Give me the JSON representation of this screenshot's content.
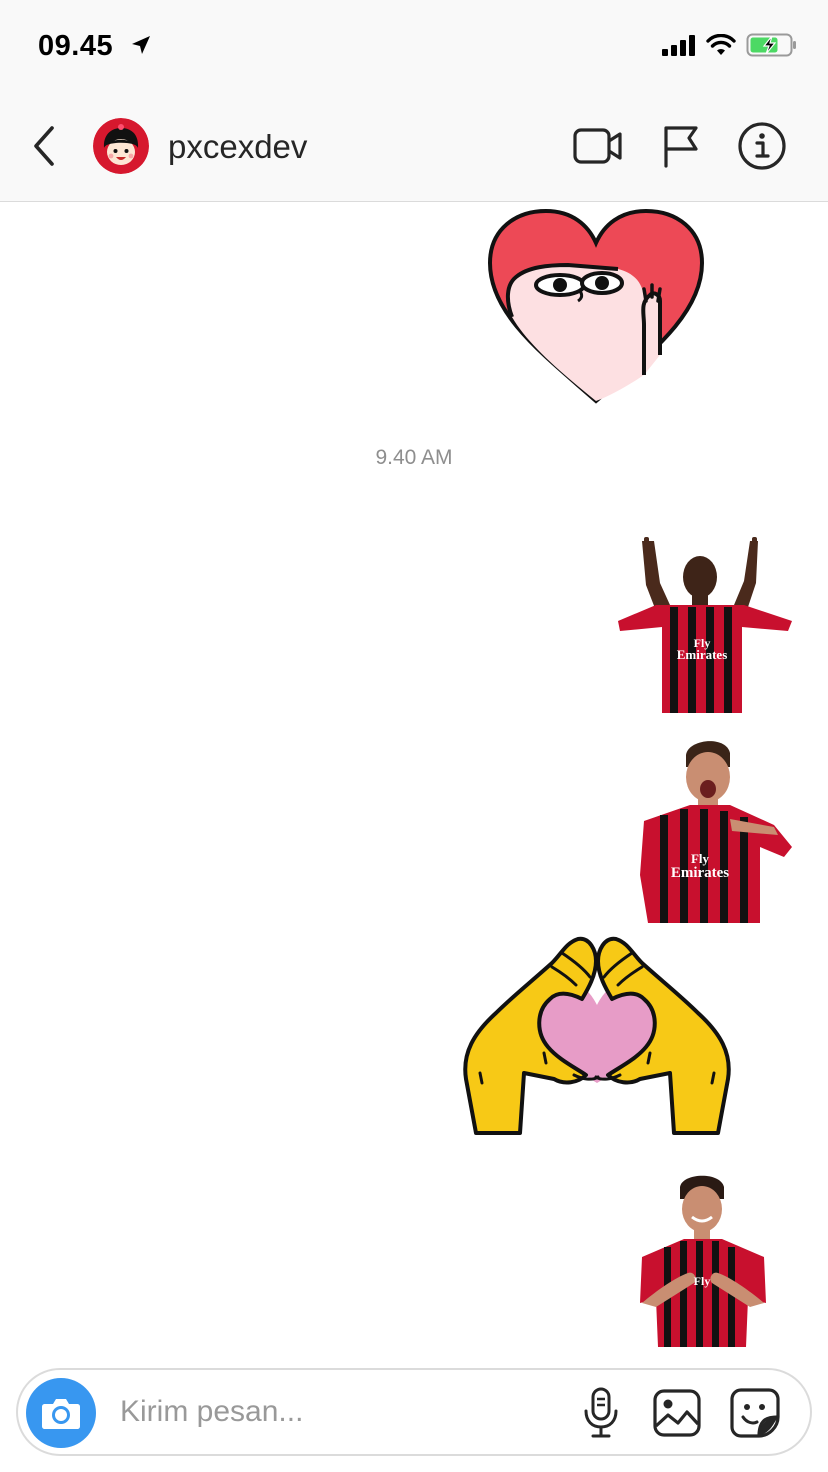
{
  "status_bar": {
    "time": "09.45",
    "icons": [
      "location-arrow-icon",
      "cellular-signal-icon",
      "wifi-icon",
      "battery-charging-icon"
    ]
  },
  "header": {
    "username": "pxcexdev",
    "icons": [
      "back-chevron-icon",
      "avatar",
      "video-call-icon",
      "flag-icon",
      "info-icon"
    ]
  },
  "conversation": {
    "timestamp": "9.40 AM",
    "messages": [
      {
        "type": "sticker",
        "sticker": "heart-peek-character",
        "sender": "other"
      },
      {
        "type": "sticker",
        "sticker": "footballer-pointing-up",
        "sender": "me"
      },
      {
        "type": "sticker",
        "sticker": "footballer-cheering",
        "sender": "me"
      },
      {
        "type": "sticker",
        "sticker": "heart-hands",
        "sender": "me"
      },
      {
        "type": "sticker",
        "sticker": "footballer-heart-gesture",
        "sender": "me"
      }
    ]
  },
  "composer": {
    "placeholder": "Kirim pesan...",
    "value": "",
    "icons": [
      "camera-icon",
      "microphone-icon",
      "gallery-icon",
      "sticker-icon"
    ]
  },
  "colors": {
    "accent_blue": "#3897f0",
    "heart_red": "#ed4956",
    "jersey_red": "#c8102e",
    "hands_yellow": "#f7c916",
    "heart_pink": "#e79cc7"
  }
}
